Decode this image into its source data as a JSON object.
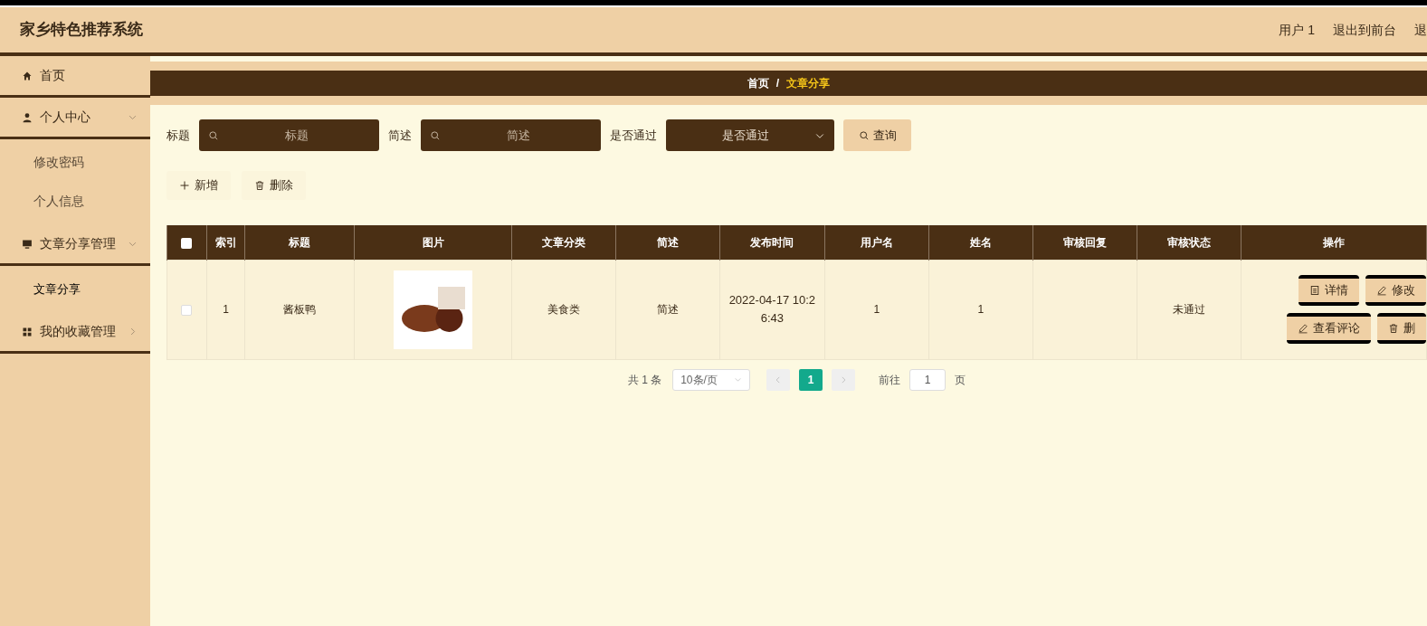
{
  "header": {
    "title": "家乡特色推荐系统",
    "links": [
      "用户 1",
      "退出到前台",
      "退"
    ]
  },
  "sidebar": {
    "items": [
      {
        "label": "首页",
        "kind": "home"
      },
      {
        "label": "个人中心",
        "kind": "user",
        "expanded": true,
        "children": [
          {
            "label": "修改密码",
            "selected": false
          },
          {
            "label": "个人信息",
            "selected": false
          }
        ]
      },
      {
        "label": "文章分享管理",
        "kind": "monitor",
        "expanded": true,
        "children": [
          {
            "label": "文章分享",
            "selected": true
          }
        ]
      },
      {
        "label": "我的收藏管理",
        "kind": "grid",
        "expanded": false
      }
    ]
  },
  "breadcrumb": {
    "items": [
      "首页",
      "文章分享"
    ],
    "separator": "/"
  },
  "search": {
    "fields": [
      {
        "label": "标题",
        "placeholder": "标题",
        "kind": "input"
      },
      {
        "label": "简述",
        "placeholder": "简述",
        "kind": "input"
      },
      {
        "label": "是否通过",
        "placeholder": "是否通过",
        "kind": "select"
      }
    ],
    "button": "查询"
  },
  "actions": [
    {
      "label": "新增",
      "kind": "add"
    },
    {
      "label": "删除",
      "kind": "delete"
    }
  ],
  "table": {
    "all_checked": false,
    "columns": [
      "索引",
      "标题",
      "图片",
      "文章分类",
      "简述",
      "发布时间",
      "用户名",
      "姓名",
      "审核回复",
      "审核状态",
      "操作"
    ],
    "rows": [
      {
        "checked": false,
        "cells": [
          "1",
          "酱板鸭",
          "",
          "美食类",
          "简述",
          "2022-04-17 10:26:43",
          "1",
          "1",
          "",
          "未通过"
        ],
        "buttons": [
          {
            "label": "详情",
            "kind": "detail"
          },
          {
            "label": "修改",
            "kind": "edit"
          },
          {
            "label": "查看评论",
            "kind": "edit"
          },
          {
            "label": "删",
            "kind": "delete"
          }
        ]
      }
    ]
  },
  "pagination": {
    "total": "共 1 条",
    "page_size": "10条/页",
    "pages": [
      {
        "label": "1",
        "selected": true
      }
    ],
    "goto_label": "前往",
    "goto_value": "1",
    "page_suffix": "页"
  }
}
